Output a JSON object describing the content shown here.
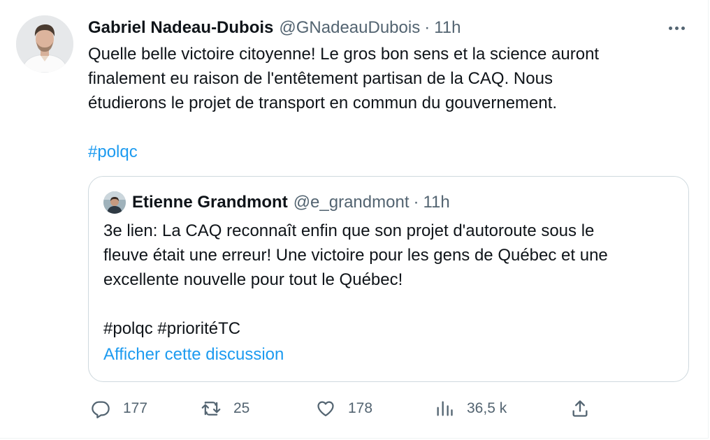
{
  "tweet": {
    "author": {
      "display_name": "Gabriel Nadeau-Dubois",
      "handle": "@GNadeauDubois",
      "separator": "·",
      "time": "11h"
    },
    "text_lines": [
      "Quelle belle victoire citoyenne! Le gros bon sens et la science auront",
      "finalement eu raison de l'entêtement partisan de la CAQ. Nous",
      "étudierons le projet de transport en commun du gouvernement."
    ],
    "hashtags": [
      "#polqc"
    ]
  },
  "quote": {
    "author": {
      "display_name": "Etienne Grandmont",
      "handle": "@e_grandmont",
      "separator": "·",
      "time": "11h"
    },
    "text_lines": [
      "3e lien: La CAQ reconnaît enfin que son projet d'autoroute sous le",
      "fleuve était une erreur! Une victoire pour les gens de Québec et une",
      "excellente nouvelle pour tout le Québec!"
    ],
    "hashtags": [
      "#polqc",
      "#prioritéTC"
    ],
    "show_thread_label": "Afficher cette discussion"
  },
  "actions": {
    "replies": "177",
    "retweets": "25",
    "likes": "178",
    "views": "36,5 k"
  },
  "icons": {
    "reply": "reply-icon",
    "retweet": "retweet-icon",
    "like": "heart-icon",
    "views": "analytics-icon",
    "share": "share-icon",
    "more": "more-icon"
  },
  "colors": {
    "link": "#1d9bf0",
    "secondary_text": "#536471",
    "primary_text": "#0f1419",
    "border": "#cfd9de"
  }
}
